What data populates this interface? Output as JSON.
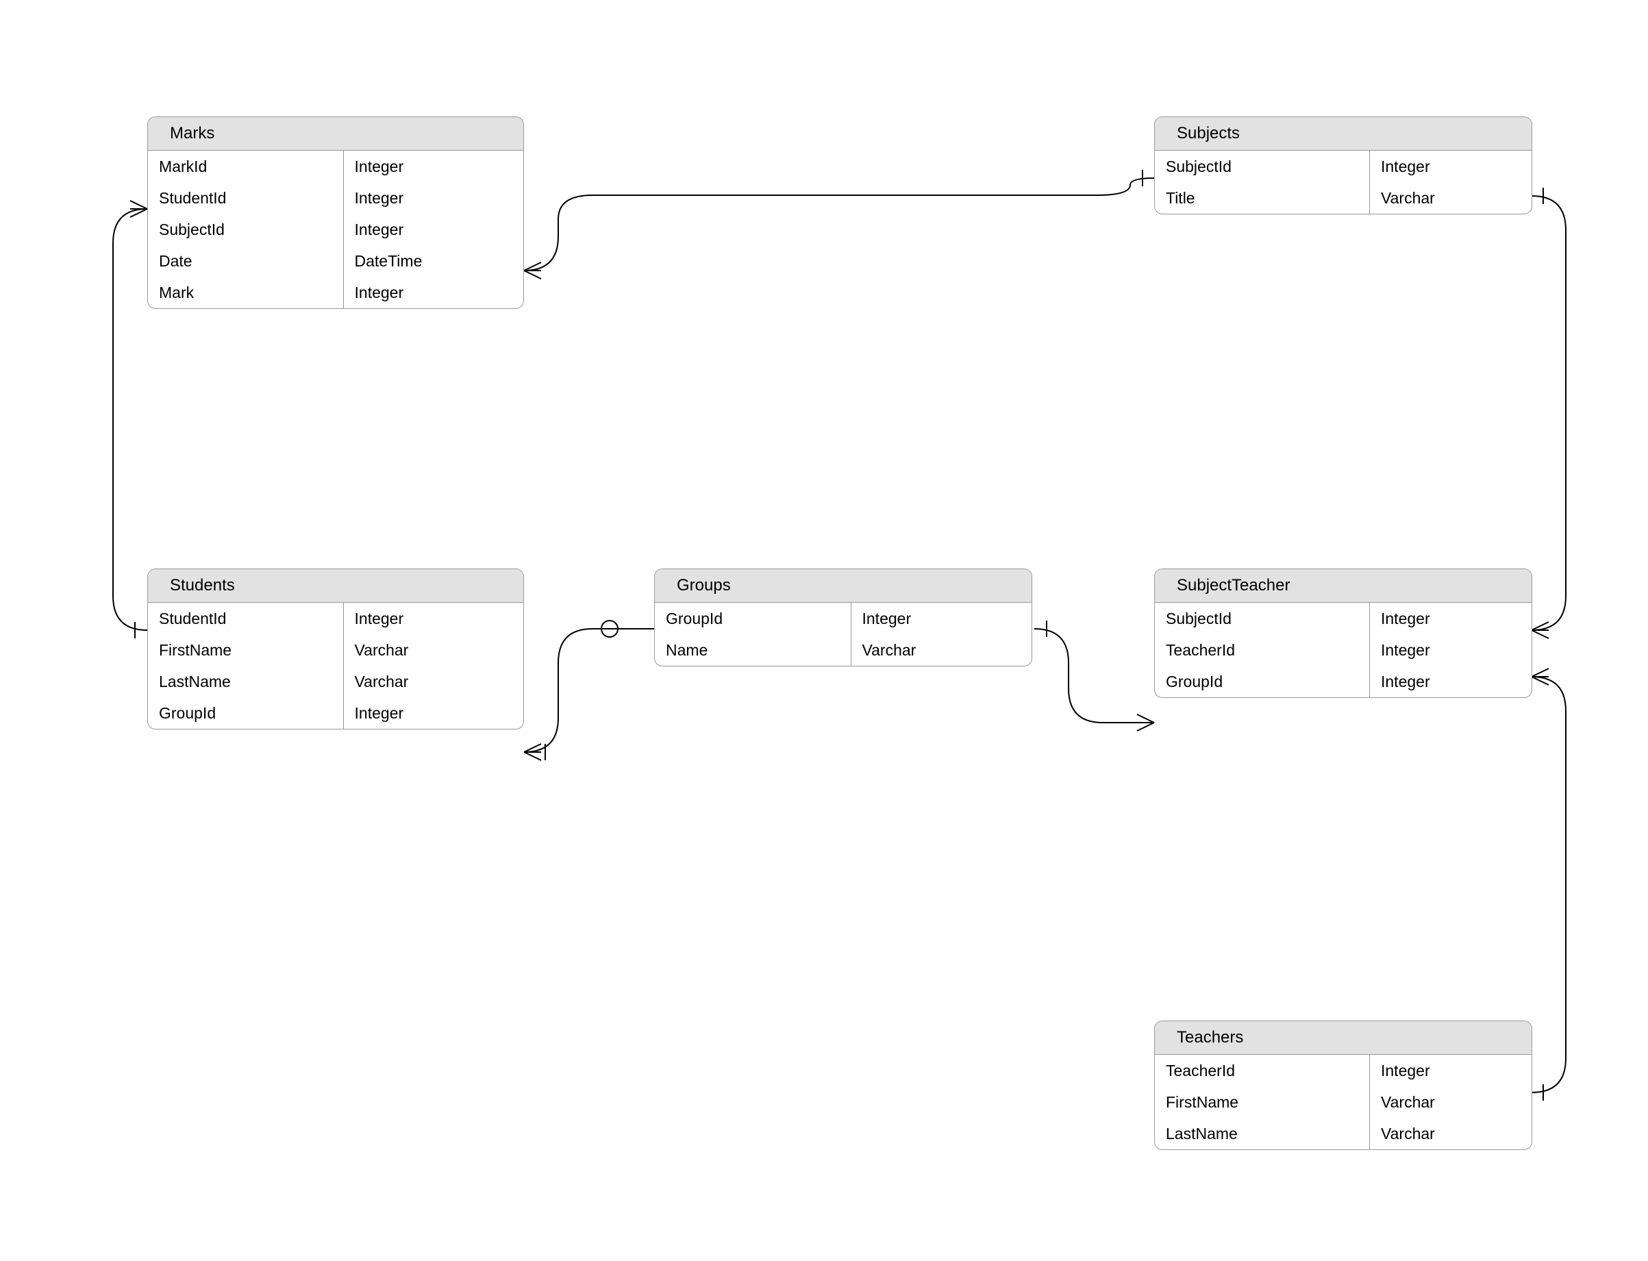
{
  "entities": {
    "marks": {
      "title": "Marks",
      "attrs": [
        {
          "name": "MarkId",
          "type": "Integer"
        },
        {
          "name": "StudentId",
          "type": "Integer"
        },
        {
          "name": "SubjectId",
          "type": "Integer"
        },
        {
          "name": "Date",
          "type": "DateTime"
        },
        {
          "name": "Mark",
          "type": "Integer"
        }
      ]
    },
    "subjects": {
      "title": "Subjects",
      "attrs": [
        {
          "name": "SubjectId",
          "type": "Integer"
        },
        {
          "name": "Title",
          "type": "Varchar"
        }
      ]
    },
    "students": {
      "title": "Students",
      "attrs": [
        {
          "name": "StudentId",
          "type": "Integer"
        },
        {
          "name": "FirstName",
          "type": "Varchar"
        },
        {
          "name": "LastName",
          "type": "Varchar"
        },
        {
          "name": "GroupId",
          "type": "Integer"
        }
      ]
    },
    "groups": {
      "title": "Groups",
      "attrs": [
        {
          "name": "GroupId",
          "type": "Integer"
        },
        {
          "name": "Name",
          "type": "Varchar"
        }
      ]
    },
    "subjectteacher": {
      "title": "SubjectTeacher",
      "attrs": [
        {
          "name": "SubjectId",
          "type": "Integer"
        },
        {
          "name": "TeacherId",
          "type": "Integer"
        },
        {
          "name": "GroupId",
          "type": "Integer"
        }
      ]
    },
    "teachers": {
      "title": "Teachers",
      "attrs": [
        {
          "name": "TeacherId",
          "type": "Integer"
        },
        {
          "name": "FirstName",
          "type": "Varchar"
        },
        {
          "name": "LastName",
          "type": "Varchar"
        }
      ]
    }
  },
  "relationships": [
    {
      "from": "Marks",
      "to": "Students",
      "from_card": "many",
      "to_card": "one"
    },
    {
      "from": "Marks",
      "to": "Subjects",
      "from_card": "many",
      "to_card": "one"
    },
    {
      "from": "Students",
      "to": "Groups",
      "from_card": "one-or-many",
      "to_card": "zero-or-one"
    },
    {
      "from": "SubjectTeacher",
      "to": "Groups",
      "from_card": "many",
      "to_card": "one"
    },
    {
      "from": "SubjectTeacher",
      "to": "Subjects",
      "from_card": "many",
      "to_card": "one"
    },
    {
      "from": "SubjectTeacher",
      "to": "Teachers",
      "from_card": "many",
      "to_card": "one"
    }
  ]
}
